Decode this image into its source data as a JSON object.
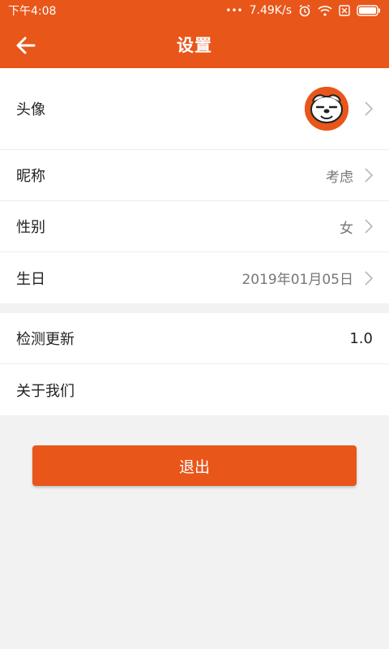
{
  "status_bar": {
    "time": "下午4:08",
    "dots": "•••",
    "speed": "7.49K/s"
  },
  "header": {
    "title": "设置"
  },
  "profile": [
    {
      "label": "头像",
      "value": ""
    },
    {
      "label": "昵称",
      "value": "考虑"
    },
    {
      "label": "性别",
      "value": "女"
    },
    {
      "label": "生日",
      "value": "2019年01月05日"
    }
  ],
  "app": [
    {
      "label": "检测更新",
      "value": "1.0"
    },
    {
      "label": "关于我们",
      "value": ""
    }
  ],
  "logout": {
    "label": "退出"
  },
  "colors": {
    "accent": "#e8561a",
    "background": "#f2f2f2"
  },
  "icons": [
    "back-arrow-icon",
    "alarm-icon",
    "wifi-icon",
    "sim-icon",
    "battery-icon",
    "chevron-right-icon"
  ]
}
